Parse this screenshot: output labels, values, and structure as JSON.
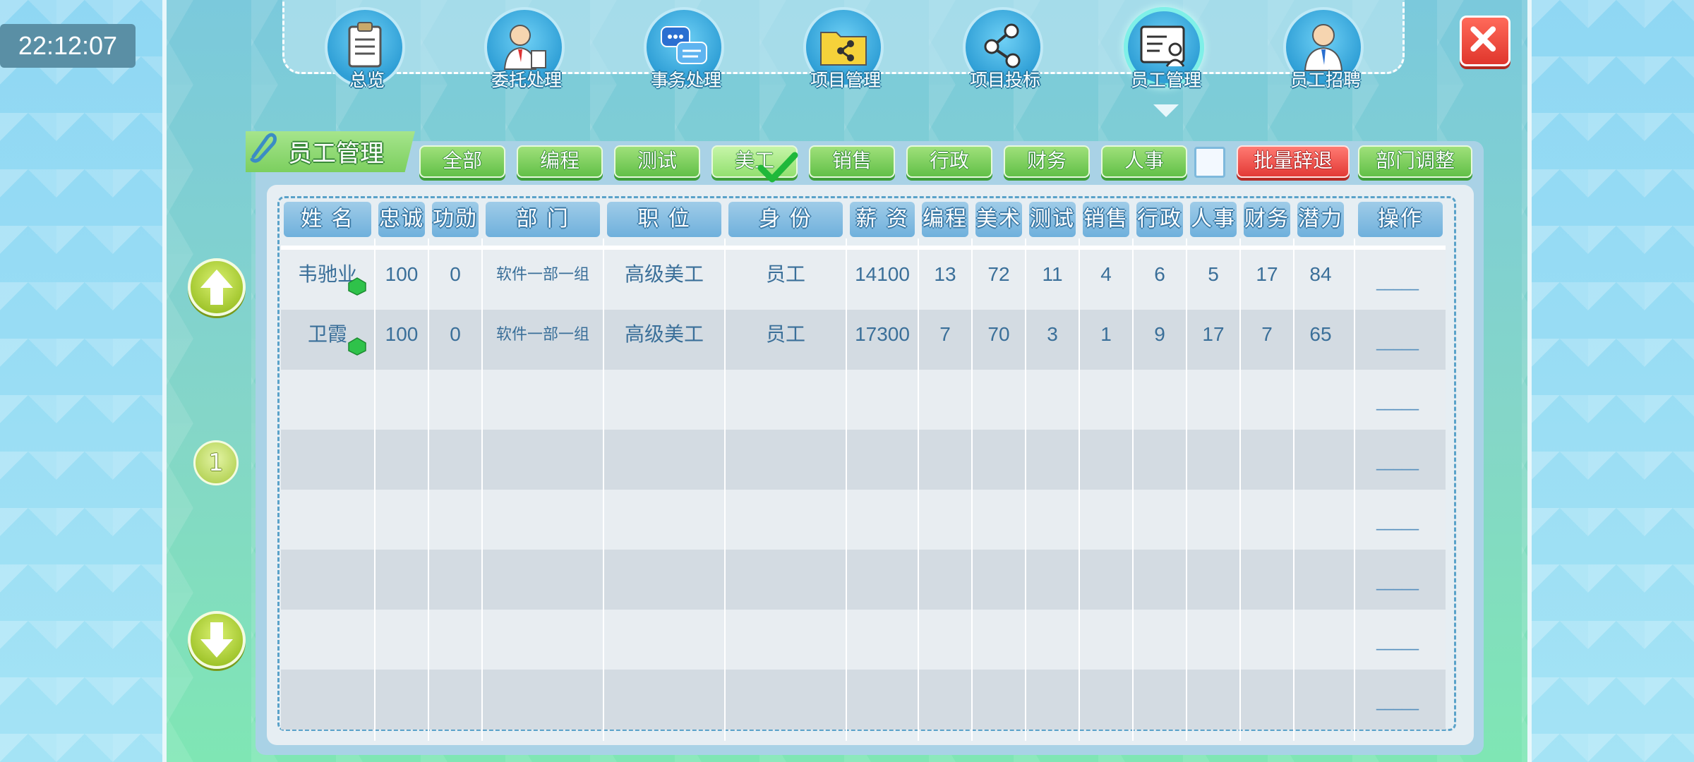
{
  "clock": "22:12:07",
  "nav": [
    {
      "label": "总览",
      "icon": "clipboard-icon"
    },
    {
      "label": "委托处理",
      "icon": "businessman-document-icon"
    },
    {
      "label": "事务处理",
      "icon": "chat-bubbles-icon"
    },
    {
      "label": "项目管理",
      "icon": "folder-share-icon"
    },
    {
      "label": "项目投标",
      "icon": "share-nodes-icon"
    },
    {
      "label": "员工管理",
      "icon": "employee-card-icon"
    },
    {
      "label": "员工招聘",
      "icon": "businessman-icon"
    }
  ],
  "panel": {
    "title": "员工管理",
    "filters": [
      "全部",
      "编程",
      "测试",
      "美工",
      "销售",
      "行政",
      "财务",
      "人事"
    ],
    "selected_filter": "美工",
    "batch_dismiss_label": "批量辞退",
    "dept_adjust_label": "部门调整"
  },
  "table": {
    "headers": [
      "姓 名",
      "忠诚",
      "功勋",
      "部 门",
      "职 位",
      "身 份",
      "薪 资",
      "编程",
      "美术",
      "测试",
      "销售",
      "行政",
      "人事",
      "财务",
      "潜力",
      "操作"
    ],
    "rows": [
      [
        "韦驰业",
        "100",
        "0",
        "软件一部一组",
        "高级美工",
        "员工",
        "14100",
        "13",
        "72",
        "11",
        "4",
        "6",
        "5",
        "17",
        "84"
      ],
      [
        "卫霞",
        "100",
        "0",
        "软件一部一组",
        "高级美工",
        "员工",
        "17300",
        "7",
        "70",
        "3",
        "1",
        "9",
        "17",
        "7",
        "65"
      ]
    ],
    "op_placeholder": "_____"
  },
  "pager": {
    "page": "1"
  },
  "colors": {
    "accent_green": "#62c048",
    "danger_red": "#e33a36",
    "header_blue": "#6fb0dc",
    "text_blue": "#3a6f99"
  }
}
